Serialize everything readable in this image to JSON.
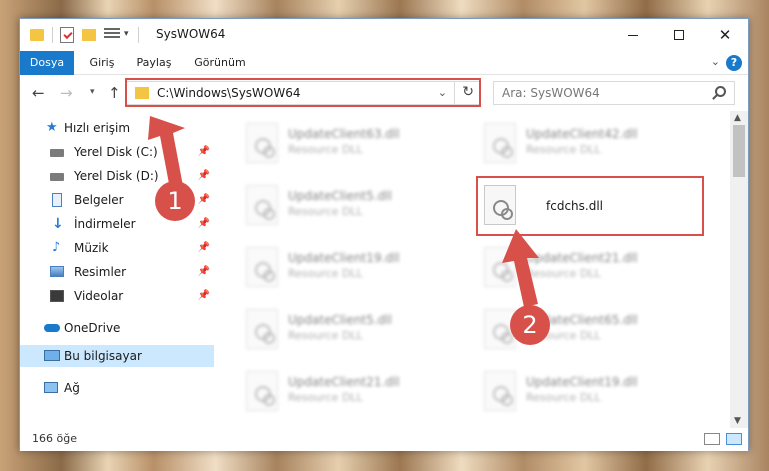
{
  "window": {
    "title": "SysWOW64"
  },
  "ribbon": {
    "tabs": [
      "Dosya",
      "Giriş",
      "Paylaş",
      "Görünüm"
    ]
  },
  "address": {
    "path": "C:\\Windows\\SysWOW64",
    "search_placeholder": "Ara: SysWOW64"
  },
  "sidebar": {
    "items": [
      {
        "label": "Hızlı erişim",
        "icon": "star-icon"
      },
      {
        "label": "Yerel Disk (C:)",
        "icon": "drive-icon",
        "pinned": true
      },
      {
        "label": "Yerel Disk (D:)",
        "icon": "drive-icon",
        "pinned": true
      },
      {
        "label": "Belgeler",
        "icon": "documents-icon",
        "pinned": true
      },
      {
        "label": "İndirmeler",
        "icon": "download-icon",
        "pinned": true
      },
      {
        "label": "Müzik",
        "icon": "music-icon",
        "pinned": true
      },
      {
        "label": "Resimler",
        "icon": "pictures-icon",
        "pinned": true
      },
      {
        "label": "Videolar",
        "icon": "videos-icon",
        "pinned": true
      },
      {
        "label": "OneDrive",
        "icon": "onedrive-icon"
      },
      {
        "label": "Bu bilgisayar",
        "icon": "computer-icon",
        "selected": true
      },
      {
        "label": "Ağ",
        "icon": "network-icon"
      }
    ]
  },
  "files": [
    {
      "name": "UpdateClient63.dll",
      "type": "Resource DLL"
    },
    {
      "name": "UpdateClient42.dll",
      "type": "Resource DLL"
    },
    {
      "name": "UpdateClient5.dll",
      "type": "Resource DLL"
    },
    {
      "name": "fcdchs.dll",
      "type": ""
    },
    {
      "name": "UpdateClient19.dll",
      "type": "Resource DLL"
    },
    {
      "name": "UpdateClient21.dll",
      "type": "Resource DLL"
    },
    {
      "name": "UpdateClient5.dll",
      "type": "Resource DLL"
    },
    {
      "name": "UpdateClient65.dll",
      "type": "Resource DLL"
    },
    {
      "name": "UpdateClient21.dll",
      "type": "Resource DLL"
    },
    {
      "name": "UpdateClient19.dll",
      "type": "Resource DLL"
    }
  ],
  "status": {
    "count": "166 öğe"
  },
  "annotations": {
    "badge1": "1",
    "badge2": "2",
    "color": "#d8504a"
  }
}
